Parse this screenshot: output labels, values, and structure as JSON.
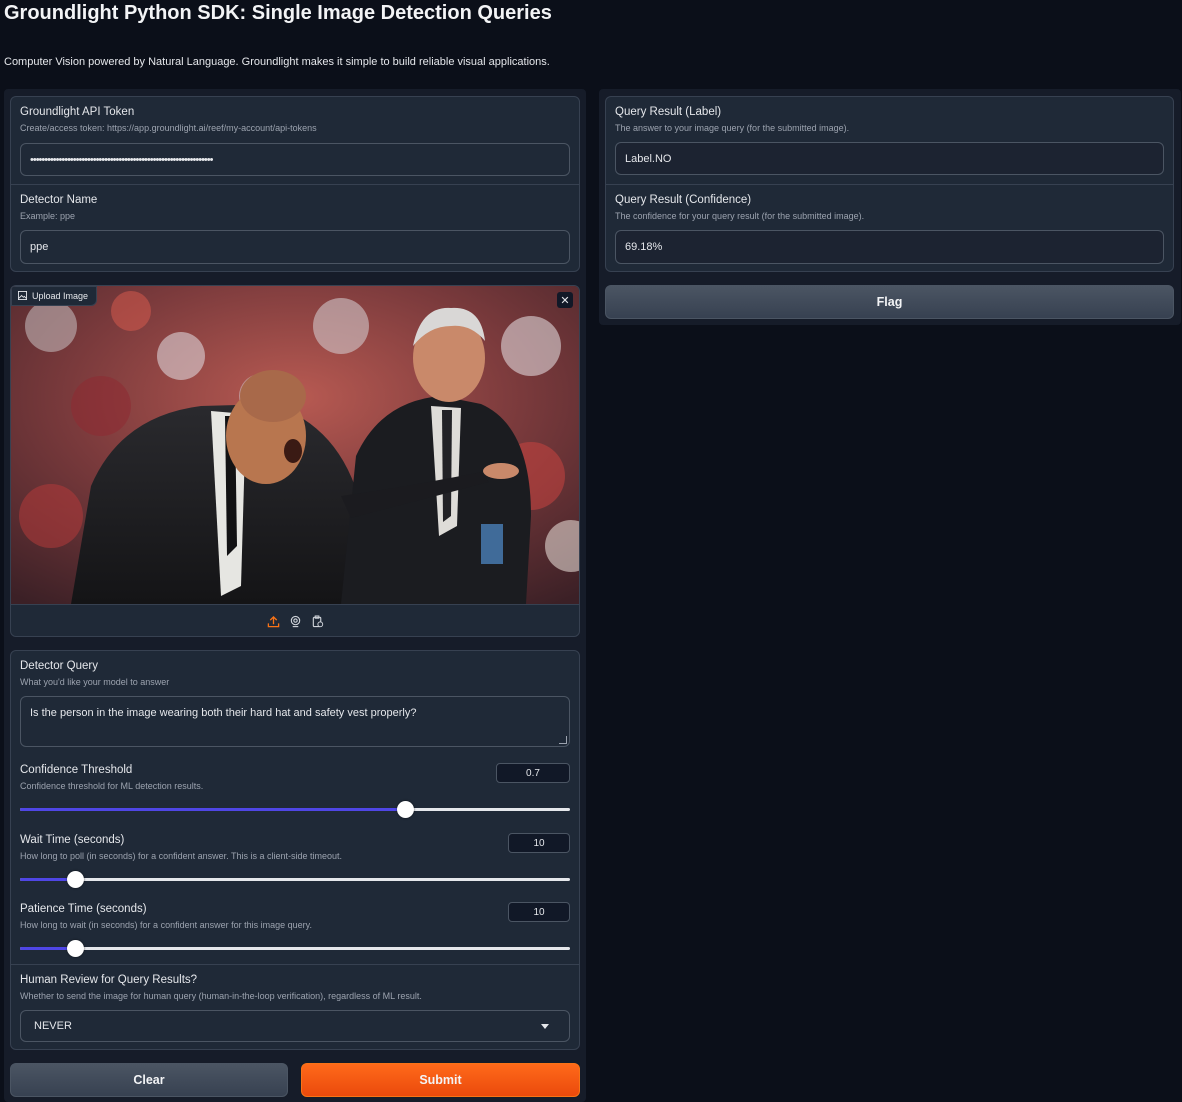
{
  "header": {
    "title": "Groundlight Python SDK: Single Image Detection Queries",
    "subtitle": "Computer Vision powered by Natural Language. Groundlight makes it simple to build reliable visual applications."
  },
  "api_token": {
    "label": "Groundlight API Token",
    "info": "Create/access token: https://app.groundlight.ai/reef/my-account/api-tokens",
    "value": "••••••••••••••••••••••••••••••••••••••••••••••••••••••••••••••••"
  },
  "detector_name": {
    "label": "Detector Name",
    "info": "Example: ppe",
    "value": "ppe"
  },
  "image": {
    "label": "Upload Image",
    "close_glyph": "✕"
  },
  "detector_query": {
    "label": "Detector Query",
    "info": "What you'd like your model to answer",
    "value": "Is the person in the image wearing both their hard hat and safety vest properly?"
  },
  "confidence_threshold": {
    "label": "Confidence Threshold",
    "info": "Confidence threshold for ML detection results.",
    "value": "0.7",
    "fraction": 0.7
  },
  "wait_time": {
    "label": "Wait Time (seconds)",
    "info": "How long to poll (in seconds) for a confident answer. This is a client-side timeout.",
    "value": "10",
    "fraction": 0.1
  },
  "patience_time": {
    "label": "Patience Time (seconds)",
    "info": "How long to wait (in seconds) for a confident answer for this image query.",
    "value": "10",
    "fraction": 0.1
  },
  "human_review": {
    "label": "Human Review for Query Results?",
    "info": "Whether to send the image for human query (human-in-the-loop verification), regardless of ML result.",
    "value": "NEVER"
  },
  "buttons": {
    "clear": "Clear",
    "submit": "Submit",
    "flag": "Flag"
  },
  "result_label": {
    "label": "Query Result (Label)",
    "info": "The answer to your image query (for the submitted image).",
    "value": "Label.NO"
  },
  "result_confidence": {
    "label": "Query Result (Confidence)",
    "info": "The confidence for your query result (for the submitted image).",
    "value": "69.18%"
  },
  "colors": {
    "background": "#0b0f19",
    "panel": "#1f2937",
    "accent_primary": "#ea580c",
    "slider_fill": "#4f46e5"
  }
}
